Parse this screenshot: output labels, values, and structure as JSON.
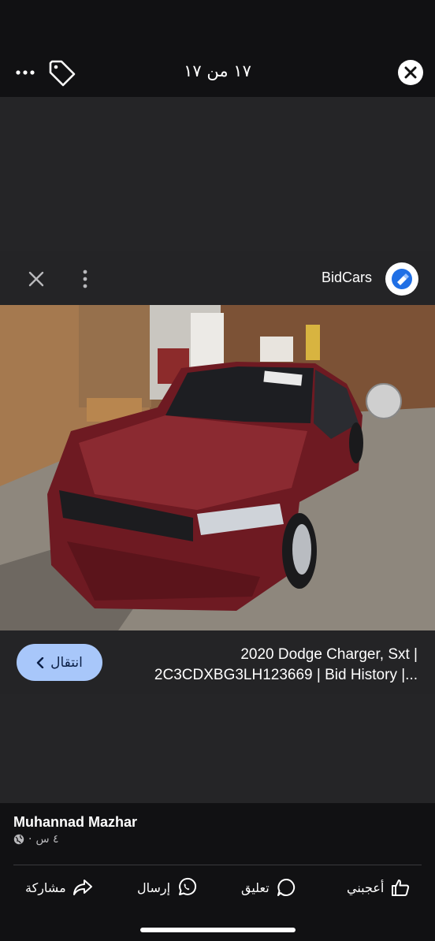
{
  "viewer": {
    "counter": "١٧ من ١٧",
    "more_icon": "more-icon",
    "tag_icon": "tag-icon",
    "close_icon": "close-icon"
  },
  "ad": {
    "advertiser": "BidCars",
    "dismiss_icon": "close-icon",
    "menu_icon": "vertical-dots-icon",
    "logo_icon": "bidcars-logo",
    "title_line1": "2020 Dodge Charger, Sxt |",
    "title_line2": "2C3CDXBG3LH123669 | Bid History |...",
    "cta_label": "انتقال",
    "image_alt": "Dodge Charger damaged front"
  },
  "post": {
    "author": "Muhannad Mazhar",
    "time": "٤ س",
    "separator": "·",
    "privacy_icon": "globe-icon"
  },
  "actions": {
    "like": "أعجبني",
    "comment": "تعليق",
    "send": "إرسال",
    "share": "مشاركة"
  },
  "colors": {
    "cta_background": "#a8c7fa",
    "page_background": "#1b1b1d"
  }
}
